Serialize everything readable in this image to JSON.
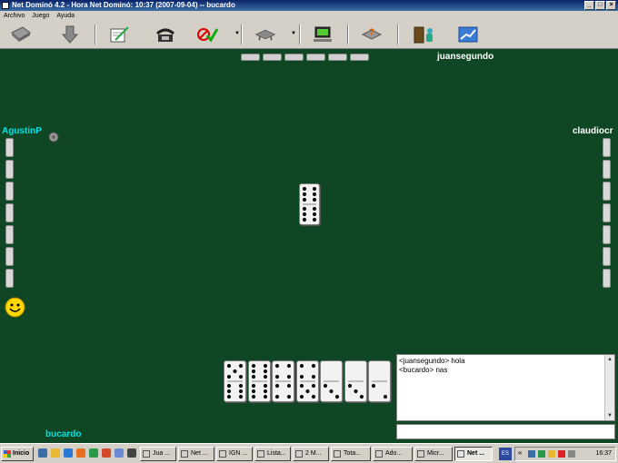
{
  "window": {
    "title": "Net Dominó 4.2  -  Hora Net Dominó: 10:37 (2007-09-04)  --  bucardo"
  },
  "menu": [
    "Archivo",
    "Juego",
    "Ayuda"
  ],
  "toolbar": {
    "icons": [
      "tiles-icon",
      "arrow-down-icon",
      "notepad-pen-icon",
      "telephone-icon",
      "no-entry-check-icon",
      "table-icon",
      "computer-icon",
      "question-help-icon",
      "door-exit-icon",
      "chart-line-icon"
    ]
  },
  "players": {
    "top": "juansegundo",
    "left": "AgustinP",
    "right": "claudiocr",
    "bottom": "bucardo"
  },
  "board": {
    "center_tile": [
      6,
      6
    ]
  },
  "hand": [
    [
      5,
      6
    ],
    [
      6,
      6
    ],
    [
      4,
      4
    ],
    [
      4,
      5
    ],
    [
      0,
      3
    ],
    [
      0,
      3
    ],
    [
      0,
      2
    ]
  ],
  "chat": {
    "lines": [
      "<juansegundo> hola",
      "<bucardo> nas"
    ],
    "input_value": ""
  },
  "taskbar": {
    "start": "Inicio",
    "tasks": [
      "Jua ...",
      "Net ...",
      "IGN ...",
      "Lista...",
      "2 M...",
      "Tota...",
      "Ado...",
      "Micr...",
      "Net ..."
    ],
    "lang": "ES",
    "clock": "16:37"
  },
  "colors": {
    "felt": "#0f4725",
    "name_cyan": "#00e0e0",
    "name_white": "#ffffff"
  }
}
